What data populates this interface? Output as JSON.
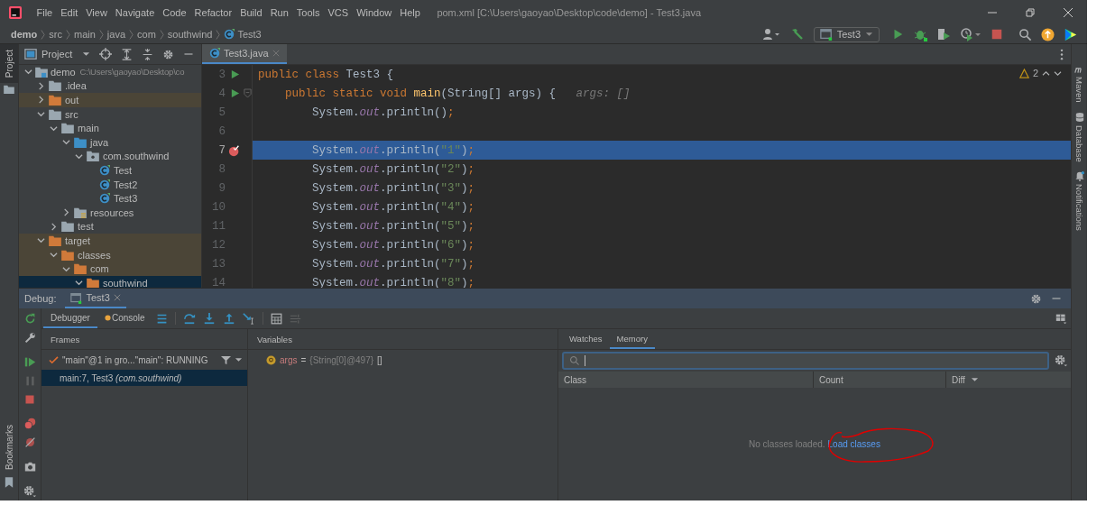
{
  "menu": [
    "File",
    "Edit",
    "View",
    "Navigate",
    "Code",
    "Refactor",
    "Build",
    "Run",
    "Tools",
    "VCS",
    "Window",
    "Help"
  ],
  "window_title": "pom.xml [C:\\Users\\gaoyao\\Desktop\\code\\demo] - Test3.java",
  "breadcrumb": [
    "demo",
    "src",
    "main",
    "java",
    "com",
    "southwind",
    "Test3"
  ],
  "run_config": "Test3",
  "left_stripe": {
    "top": "Project",
    "bottom": "Bookmarks"
  },
  "right_stripe": [
    "Maven",
    "Database",
    "Notifications"
  ],
  "project": {
    "title": "Project",
    "tree": [
      {
        "label": "demo",
        "path": "C:\\Users\\gaoyao\\Desktop\\co",
        "kind": "module",
        "expanded": true,
        "excluded": false,
        "selected": false,
        "children": [
          {
            "label": ".idea",
            "kind": "folder",
            "expanded": false,
            "excluded": false,
            "selected": false
          },
          {
            "label": "out",
            "kind": "folder",
            "expanded": false,
            "excluded": true,
            "selected": false
          },
          {
            "label": "src",
            "kind": "folder",
            "expanded": true,
            "excluded": false,
            "selected": false,
            "children": [
              {
                "label": "main",
                "kind": "folder",
                "expanded": true,
                "excluded": false,
                "selected": false,
                "children": [
                  {
                    "label": "java",
                    "kind": "source",
                    "expanded": true,
                    "excluded": false,
                    "selected": false,
                    "children": [
                      {
                        "label": "com.southwind",
                        "kind": "package",
                        "expanded": true,
                        "excluded": false,
                        "selected": false,
                        "children": [
                          {
                            "label": "Test",
                            "kind": "class",
                            "excluded": false,
                            "selected": false
                          },
                          {
                            "label": "Test2",
                            "kind": "class",
                            "excluded": false,
                            "selected": false
                          },
                          {
                            "label": "Test3",
                            "kind": "class",
                            "excluded": false,
                            "selected": false
                          }
                        ]
                      }
                    ]
                  },
                  {
                    "label": "resources",
                    "kind": "resources",
                    "expanded": false,
                    "excluded": false,
                    "selected": false
                  }
                ]
              },
              {
                "label": "test",
                "kind": "folder",
                "expanded": false,
                "excluded": false,
                "selected": false
              }
            ]
          },
          {
            "label": "target",
            "kind": "folder",
            "expanded": true,
            "excluded": true,
            "selected": false,
            "children": [
              {
                "label": "classes",
                "kind": "folder",
                "expanded": true,
                "excluded": true,
                "selected": false,
                "children": [
                  {
                    "label": "com",
                    "kind": "folder",
                    "expanded": true,
                    "excluded": true,
                    "selected": false,
                    "children": [
                      {
                        "label": "southwind",
                        "kind": "folder",
                        "expanded": true,
                        "excluded": true,
                        "selected": true
                      }
                    ]
                  }
                ]
              }
            ]
          }
        ]
      }
    ]
  },
  "editor": {
    "tab": "Test3.java",
    "warnings": "2",
    "lines": [
      {
        "number": "3",
        "runnable": true,
        "breakpoint": false,
        "fold": false,
        "current": false,
        "tokens": [
          {
            "kind": "keyword",
            "text": "public class "
          },
          {
            "kind": "plain",
            "text": "Test3 {"
          }
        ]
      },
      {
        "number": "4",
        "runnable": true,
        "breakpoint": false,
        "fold": true,
        "current": false,
        "tokens": [
          {
            "kind": "keyword",
            "text": "    public static void "
          },
          {
            "kind": "method",
            "text": "main"
          },
          {
            "kind": "plain",
            "text": "(String[] args) {"
          },
          {
            "kind": "hint",
            "text": "   args: []"
          }
        ]
      },
      {
        "number": "5",
        "runnable": false,
        "breakpoint": false,
        "fold": false,
        "current": false,
        "tokens": [
          {
            "kind": "plain",
            "text": "        System."
          },
          {
            "kind": "field",
            "text": "out"
          },
          {
            "kind": "plain",
            "text": ".println()"
          },
          {
            "kind": "keyword",
            "text": ";"
          }
        ]
      },
      {
        "number": "6",
        "runnable": false,
        "breakpoint": false,
        "fold": false,
        "current": false
      },
      {
        "number": "7",
        "runnable": false,
        "breakpoint": true,
        "fold": false,
        "current": true,
        "tokens": [
          {
            "kind": "plain",
            "text": "        System."
          },
          {
            "kind": "field",
            "text": "out"
          },
          {
            "kind": "plain",
            "text": ".println("
          },
          {
            "kind": "string",
            "text": "\"1\""
          },
          {
            "kind": "plain",
            "text": ")"
          },
          {
            "kind": "keyword",
            "text": ";"
          }
        ]
      },
      {
        "number": "8",
        "runnable": false,
        "breakpoint": false,
        "fold": false,
        "current": false,
        "tokens": [
          {
            "kind": "plain",
            "text": "        System."
          },
          {
            "kind": "field",
            "text": "out"
          },
          {
            "kind": "plain",
            "text": ".println("
          },
          {
            "kind": "string",
            "text": "\"2\""
          },
          {
            "kind": "plain",
            "text": ")"
          },
          {
            "kind": "keyword",
            "text": ";"
          }
        ]
      },
      {
        "number": "9",
        "runnable": false,
        "breakpoint": false,
        "fold": false,
        "current": false,
        "tokens": [
          {
            "kind": "plain",
            "text": "        System."
          },
          {
            "kind": "field",
            "text": "out"
          },
          {
            "kind": "plain",
            "text": ".println("
          },
          {
            "kind": "string",
            "text": "\"3\""
          },
          {
            "kind": "plain",
            "text": ")"
          },
          {
            "kind": "keyword",
            "text": ";"
          }
        ]
      },
      {
        "number": "10",
        "runnable": false,
        "breakpoint": false,
        "fold": false,
        "current": false,
        "tokens": [
          {
            "kind": "plain",
            "text": "        System."
          },
          {
            "kind": "field",
            "text": "out"
          },
          {
            "kind": "plain",
            "text": ".println("
          },
          {
            "kind": "string",
            "text": "\"4\""
          },
          {
            "kind": "plain",
            "text": ")"
          },
          {
            "kind": "keyword",
            "text": ";"
          }
        ]
      },
      {
        "number": "11",
        "runnable": false,
        "breakpoint": false,
        "fold": false,
        "current": false,
        "tokens": [
          {
            "kind": "plain",
            "text": "        System."
          },
          {
            "kind": "field",
            "text": "out"
          },
          {
            "kind": "plain",
            "text": ".println("
          },
          {
            "kind": "string",
            "text": "\"5\""
          },
          {
            "kind": "plain",
            "text": ")"
          },
          {
            "kind": "keyword",
            "text": ";"
          }
        ]
      },
      {
        "number": "12",
        "runnable": false,
        "breakpoint": false,
        "fold": false,
        "current": false,
        "tokens": [
          {
            "kind": "plain",
            "text": "        System."
          },
          {
            "kind": "field",
            "text": "out"
          },
          {
            "kind": "plain",
            "text": ".println("
          },
          {
            "kind": "string",
            "text": "\"6\""
          },
          {
            "kind": "plain",
            "text": ")"
          },
          {
            "kind": "keyword",
            "text": ";"
          }
        ]
      },
      {
        "number": "13",
        "runnable": false,
        "breakpoint": false,
        "fold": false,
        "current": false,
        "tokens": [
          {
            "kind": "plain",
            "text": "        System."
          },
          {
            "kind": "field",
            "text": "out"
          },
          {
            "kind": "plain",
            "text": ".println("
          },
          {
            "kind": "string",
            "text": "\"7\""
          },
          {
            "kind": "plain",
            "text": ")"
          },
          {
            "kind": "keyword",
            "text": ";"
          }
        ]
      },
      {
        "number": "14",
        "runnable": false,
        "breakpoint": false,
        "fold": false,
        "current": false,
        "tokens": [
          {
            "kind": "plain",
            "text": "        System."
          },
          {
            "kind": "field",
            "text": "out"
          },
          {
            "kind": "plain",
            "text": ".println("
          },
          {
            "kind": "string",
            "text": "\"8\""
          },
          {
            "kind": "plain",
            "text": ")"
          },
          {
            "kind": "keyword",
            "text": ";"
          }
        ]
      }
    ]
  },
  "debug": {
    "label": "Debug:",
    "tab": "Test3",
    "subtabs": [
      {
        "label": "Debugger",
        "selected": true
      },
      {
        "label": "Console",
        "selected": false
      }
    ],
    "frames": {
      "title": "Frames",
      "thread": "\"main\"@1 in gro...\"main\": RUNNING",
      "rows": [
        {
          "text": "main:7, Test3 *(com.southwind)*",
          "selected": true
        }
      ]
    },
    "variables": {
      "title": "Variables",
      "items": [
        {
          "name": "args",
          "operator": "=",
          "ref": "{String[0]@497}",
          "value": "[]"
        }
      ]
    },
    "memory": {
      "tabs": [
        {
          "label": "Watches",
          "selected": false
        },
        {
          "label": "Memory",
          "selected": true
        }
      ],
      "columns": [
        "Class",
        "Count",
        "Diff"
      ],
      "empty_text": "No classes loaded.",
      "link": "Load classes"
    }
  }
}
